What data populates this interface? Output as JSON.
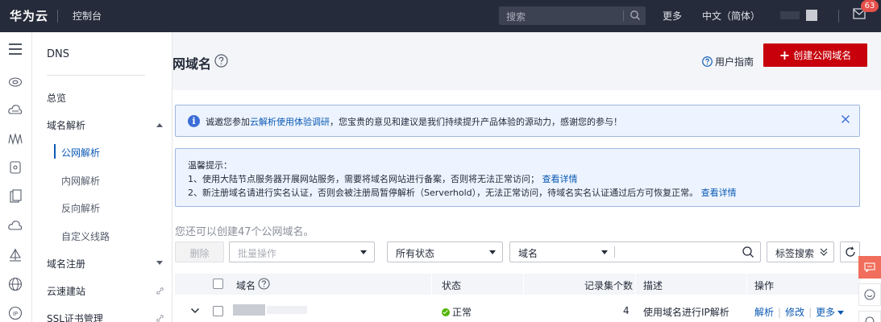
{
  "topbar": {
    "logo": "华为云",
    "console": "控制台",
    "search_placeholder": "搜索",
    "more": "更多",
    "language": "中文（简体）",
    "mail_badge": "63"
  },
  "sidebar": {
    "title": "DNS",
    "overview": "总览",
    "domain_resolution": "域名解析",
    "sub_public": "公网解析",
    "sub_private": "内网解析",
    "sub_reverse": "反向解析",
    "sub_custom": "自定义线路",
    "domain_registration": "域名注册",
    "cloud_site": "云速建站",
    "ssl": "SSL证书管理"
  },
  "header": {
    "page_title": "网域名",
    "user_guide": "用户指南",
    "create_button": "创建公网域名"
  },
  "notice1": {
    "prefix": "诚邀您参加",
    "link": "云解析使用体验调研",
    "suffix": "，您宝贵的意见和建议是我们持续提升产品体验的源动力，感谢您的参与！"
  },
  "notice2": {
    "title": "温馨提示：",
    "line1": "1、使用大陆节点服务器开展网站服务，需要将域名网站进行备案，否则将无法正常访问；",
    "line1_link": "查看详情",
    "line2": "2、新注册域名请进行实名认证，否则会被注册局暂停解析（Serverhold），无法正常访问，待域名实名认证通过后方可恢复正常。",
    "line2_link": "查看详情"
  },
  "quota_text": "您还可以创建47个公网域名。",
  "toolbar": {
    "delete": "删除",
    "batch": "批量操作",
    "status": "所有状态",
    "domain_field": "域名",
    "tag_search": "标签搜索"
  },
  "table": {
    "headers": {
      "domain": "域名",
      "status": "状态",
      "record_count": "记录集个数",
      "description": "描述",
      "actions": "操作"
    },
    "rows": [
      {
        "status": "正常",
        "record_count": "4",
        "description": "使用域名进行IP解析",
        "action_resolve": "解析",
        "action_modify": "修改",
        "action_more": "更多"
      }
    ]
  },
  "colors": {
    "topbar": "#252b3a",
    "primary_red": "#c7000b",
    "link_blue": "#0a59b3",
    "status_green": "#50b400",
    "badge_red": "#e6504b"
  }
}
